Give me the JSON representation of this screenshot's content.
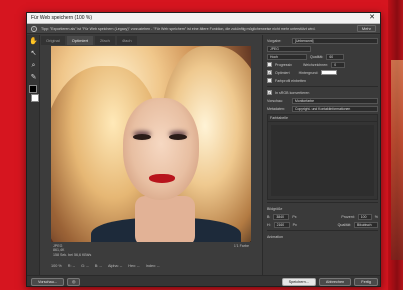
{
  "window": {
    "title": "Für Web speichern (100 %)",
    "close": "✕"
  },
  "infobar": {
    "message": "Tipp: \"Exportieren als\" ist \"Für Web speichern (Legacy)\" vorzuziehen - \"Für Web speichern\" ist eine ältere Funktion, die zukünftig möglicherweise nicht mehr unterstützt wird.",
    "more_button": "Mehr"
  },
  "tabs": [
    {
      "label": "Original",
      "active": false
    },
    {
      "label": "Optimiert",
      "active": true
    },
    {
      "label": "2fach",
      "active": false
    },
    {
      "label": "4fach",
      "active": false
    }
  ],
  "preview": {
    "meta_lines": [
      "JPEG",
      "861,4K",
      "158 Sek. bei 56,6 KBit/s",
      "60 Qualität"
    ],
    "meta_right": "1'1 Farbe"
  },
  "statusbar": {
    "zoom": "100 %",
    "items": [
      "R: --",
      "G: --",
      "B: --",
      "Alpha: --",
      "Hex: --",
      "Index: --"
    ]
  },
  "panel": {
    "preset_label": "Vorgabe:",
    "preset_value": "[Unbenannt]",
    "format_value": "JPEG",
    "quality_level": "Hoch",
    "quality_label": "Qualität:",
    "quality_value": "60",
    "progressive_label": "Progressiv",
    "blur_label": "Weichzeichnen:",
    "blur_value": "0",
    "optimized_label": "Optimiert",
    "matte_label": "Hintergrund:",
    "embed_profile_label": "Farbprofil einbetten",
    "convert_srgb_label": "In sRGB konvertieren",
    "preview_label": "Vorschau:",
    "preview_value": "Monitorfarbe",
    "metadata_label": "Metadaten:",
    "metadata_value": "Copyright- und Kontaktinformationen",
    "color_table_label": "Farbtabelle",
    "image_size_label": "Bildgröße",
    "w_label": "B:",
    "w_value": "3840",
    "h_label": "H:",
    "h_value": "2160",
    "unit": "Px",
    "percent_label": "Prozent:",
    "percent_value": "100",
    "percent_unit": "%",
    "quality2_label": "Qualität:",
    "quality2_value": "Bikubisch",
    "animation_label": "Animation"
  },
  "buttons": {
    "preview": "Vorschau...",
    "browser": "",
    "save": "Speichern...",
    "cancel": "Abbrechen",
    "done": "Fertig"
  }
}
